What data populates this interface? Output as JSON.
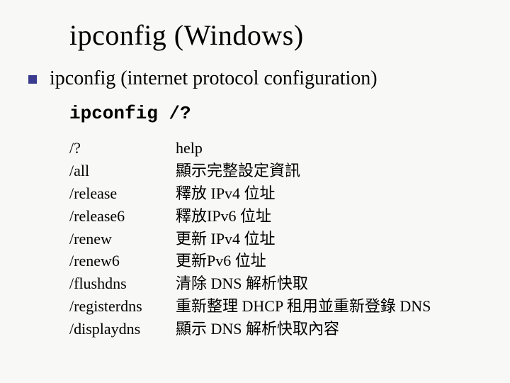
{
  "title": "ipconfig (Windows)",
  "subtitle": "ipconfig (internet protocol configuration)",
  "command": "ipconfig /?",
  "options": [
    {
      "flag": "/?",
      "desc": "help"
    },
    {
      "flag": "/all",
      "desc": "顯示完整設定資訊"
    },
    {
      "flag": "/release",
      "desc": "釋放 IPv4 位址"
    },
    {
      "flag": "/release6",
      "desc": "釋放IPv6 位址"
    },
    {
      "flag": "/renew",
      "desc": "更新 IPv4 位址"
    },
    {
      "flag": "/renew6",
      "desc": "更新Pv6 位址"
    },
    {
      "flag": "/flushdns",
      "desc": "清除 DNS 解析快取"
    },
    {
      "flag": "/registerdns",
      "desc": "重新整理 DHCP 租用並重新登錄 DNS"
    },
    {
      "flag": "/displaydns",
      "desc": "顯示 DNS 解析快取內容"
    }
  ]
}
